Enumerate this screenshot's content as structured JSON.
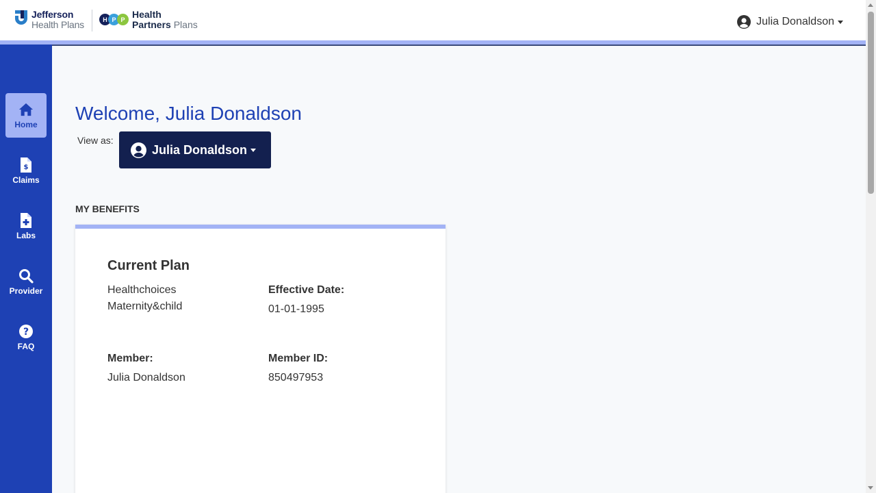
{
  "header": {
    "jefferson_line1": "Jefferson",
    "jefferson_line2": "Health Plans",
    "hpp_letters": [
      "H",
      "P",
      "P"
    ],
    "hpp_line1": "Health",
    "hpp_line2a": "Partners",
    "hpp_line2b": "Plans",
    "user_name": "Julia Donaldson"
  },
  "sidebar": {
    "items": [
      {
        "label": "Home",
        "icon": "home-icon",
        "active": true
      },
      {
        "label": "Claims",
        "icon": "claims-document-icon",
        "active": false
      },
      {
        "label": "Labs",
        "icon": "labs-document-icon",
        "active": false
      },
      {
        "label": "Provider",
        "icon": "search-icon",
        "active": false
      },
      {
        "label": "FAQ",
        "icon": "question-circle-icon",
        "active": false
      }
    ]
  },
  "main": {
    "welcome": "Welcome, Julia Donaldson",
    "view_as_label": "View as:",
    "view_as_selected": "Julia Donaldson",
    "section_title": "MY BENEFITS",
    "card": {
      "title": "Current Plan",
      "plan_name": "Healthchoices Maternity&child",
      "effective_date_label": "Effective Date:",
      "effective_date": "01-01-1995",
      "member_label": "Member:",
      "member_name": "Julia Donaldson",
      "member_id_label": "Member ID:",
      "member_id": "850497953"
    }
  },
  "colors": {
    "brand_blue": "#1e41b4",
    "accent_light": "#a3b3f5",
    "dark_navy": "#13204f",
    "hpp_h": "#15215a",
    "hpp_p1": "#3aa0dc",
    "hpp_p2": "#8cc63f"
  }
}
